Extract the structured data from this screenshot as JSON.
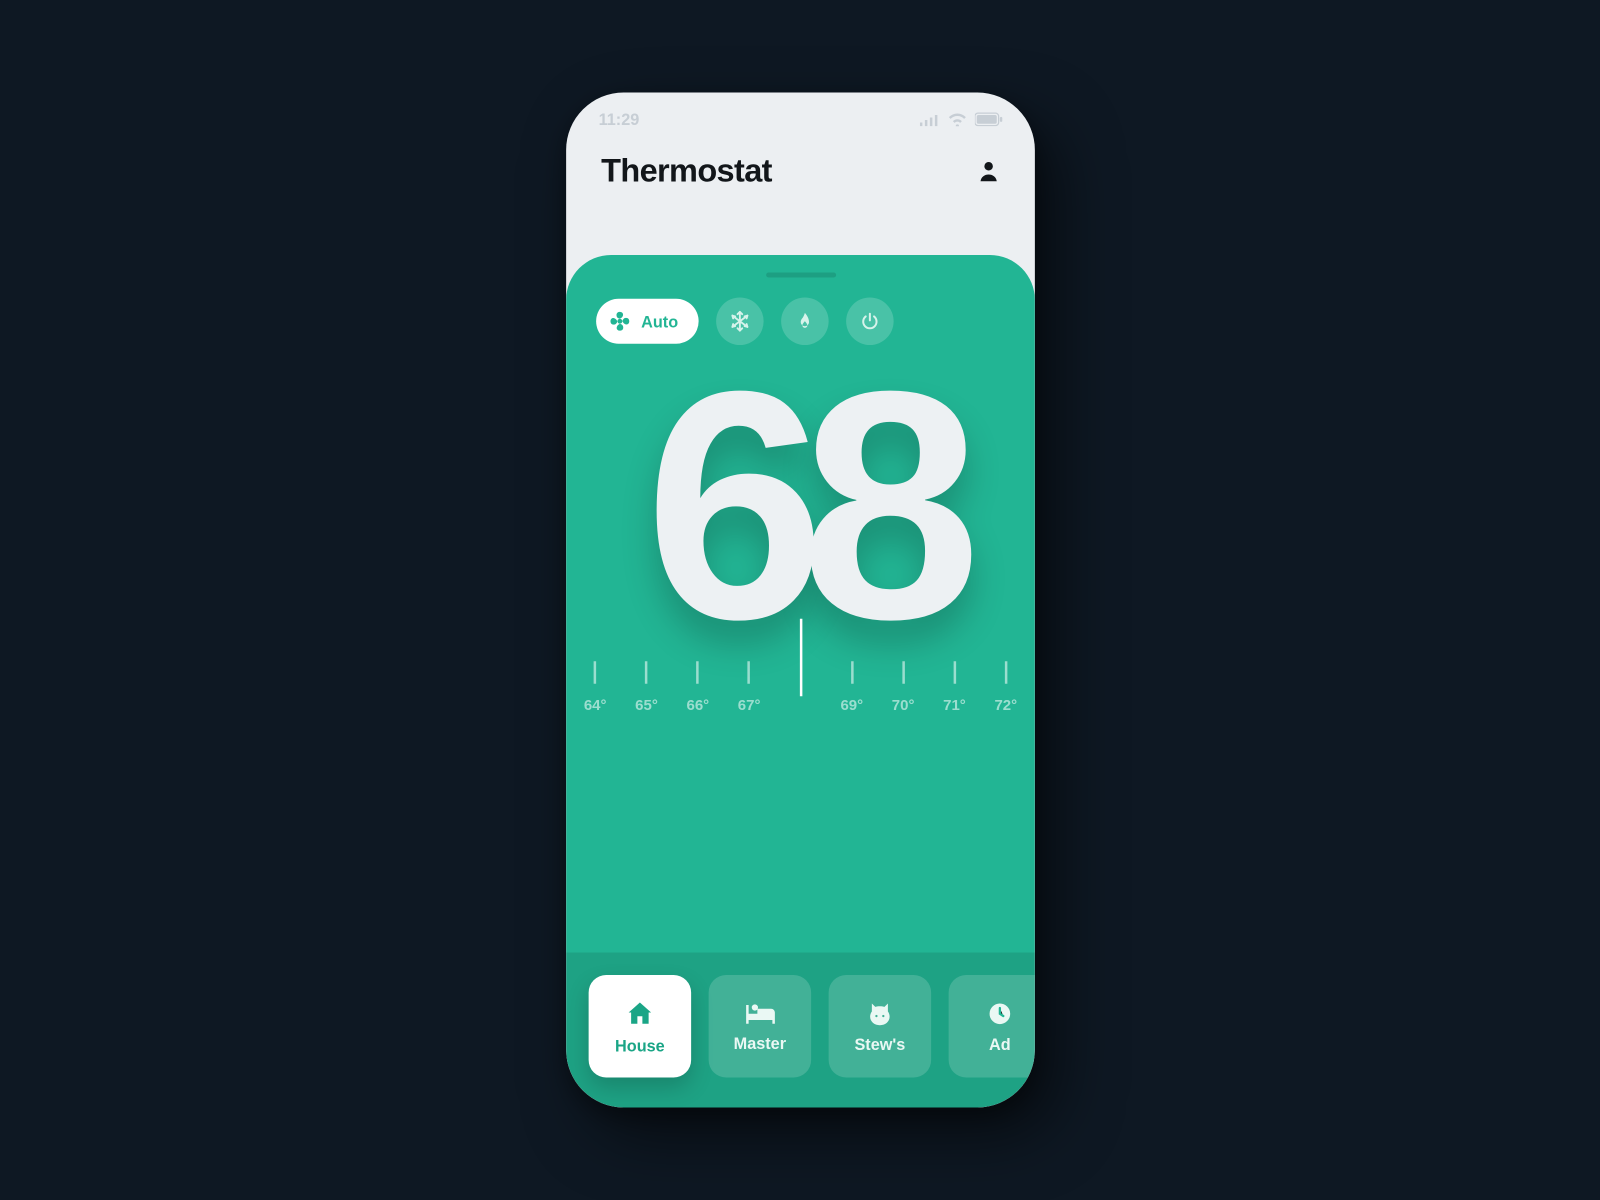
{
  "status": {
    "time": "11:29"
  },
  "header": {
    "title": "Thermostat"
  },
  "modes": {
    "auto_label": "Auto",
    "icons": {
      "fan": "fan-icon",
      "snow": "snowflake-icon",
      "flame": "flame-icon",
      "power": "power-icon"
    }
  },
  "temperature": {
    "value": "68"
  },
  "scale": {
    "ticks": [
      "64°",
      "65°",
      "66°",
      "67°",
      "",
      "69°",
      "70°",
      "71°",
      "72°"
    ]
  },
  "rooms": [
    {
      "label": "House",
      "icon": "home",
      "active": true
    },
    {
      "label": "Master",
      "icon": "bed",
      "active": false
    },
    {
      "label": "Stew's",
      "icon": "cat",
      "active": false
    },
    {
      "label": "Ad",
      "icon": "clock",
      "active": false
    }
  ],
  "colors": {
    "accent": "#22b594",
    "bg": "#0e1823",
    "panel": "#eceff2"
  }
}
